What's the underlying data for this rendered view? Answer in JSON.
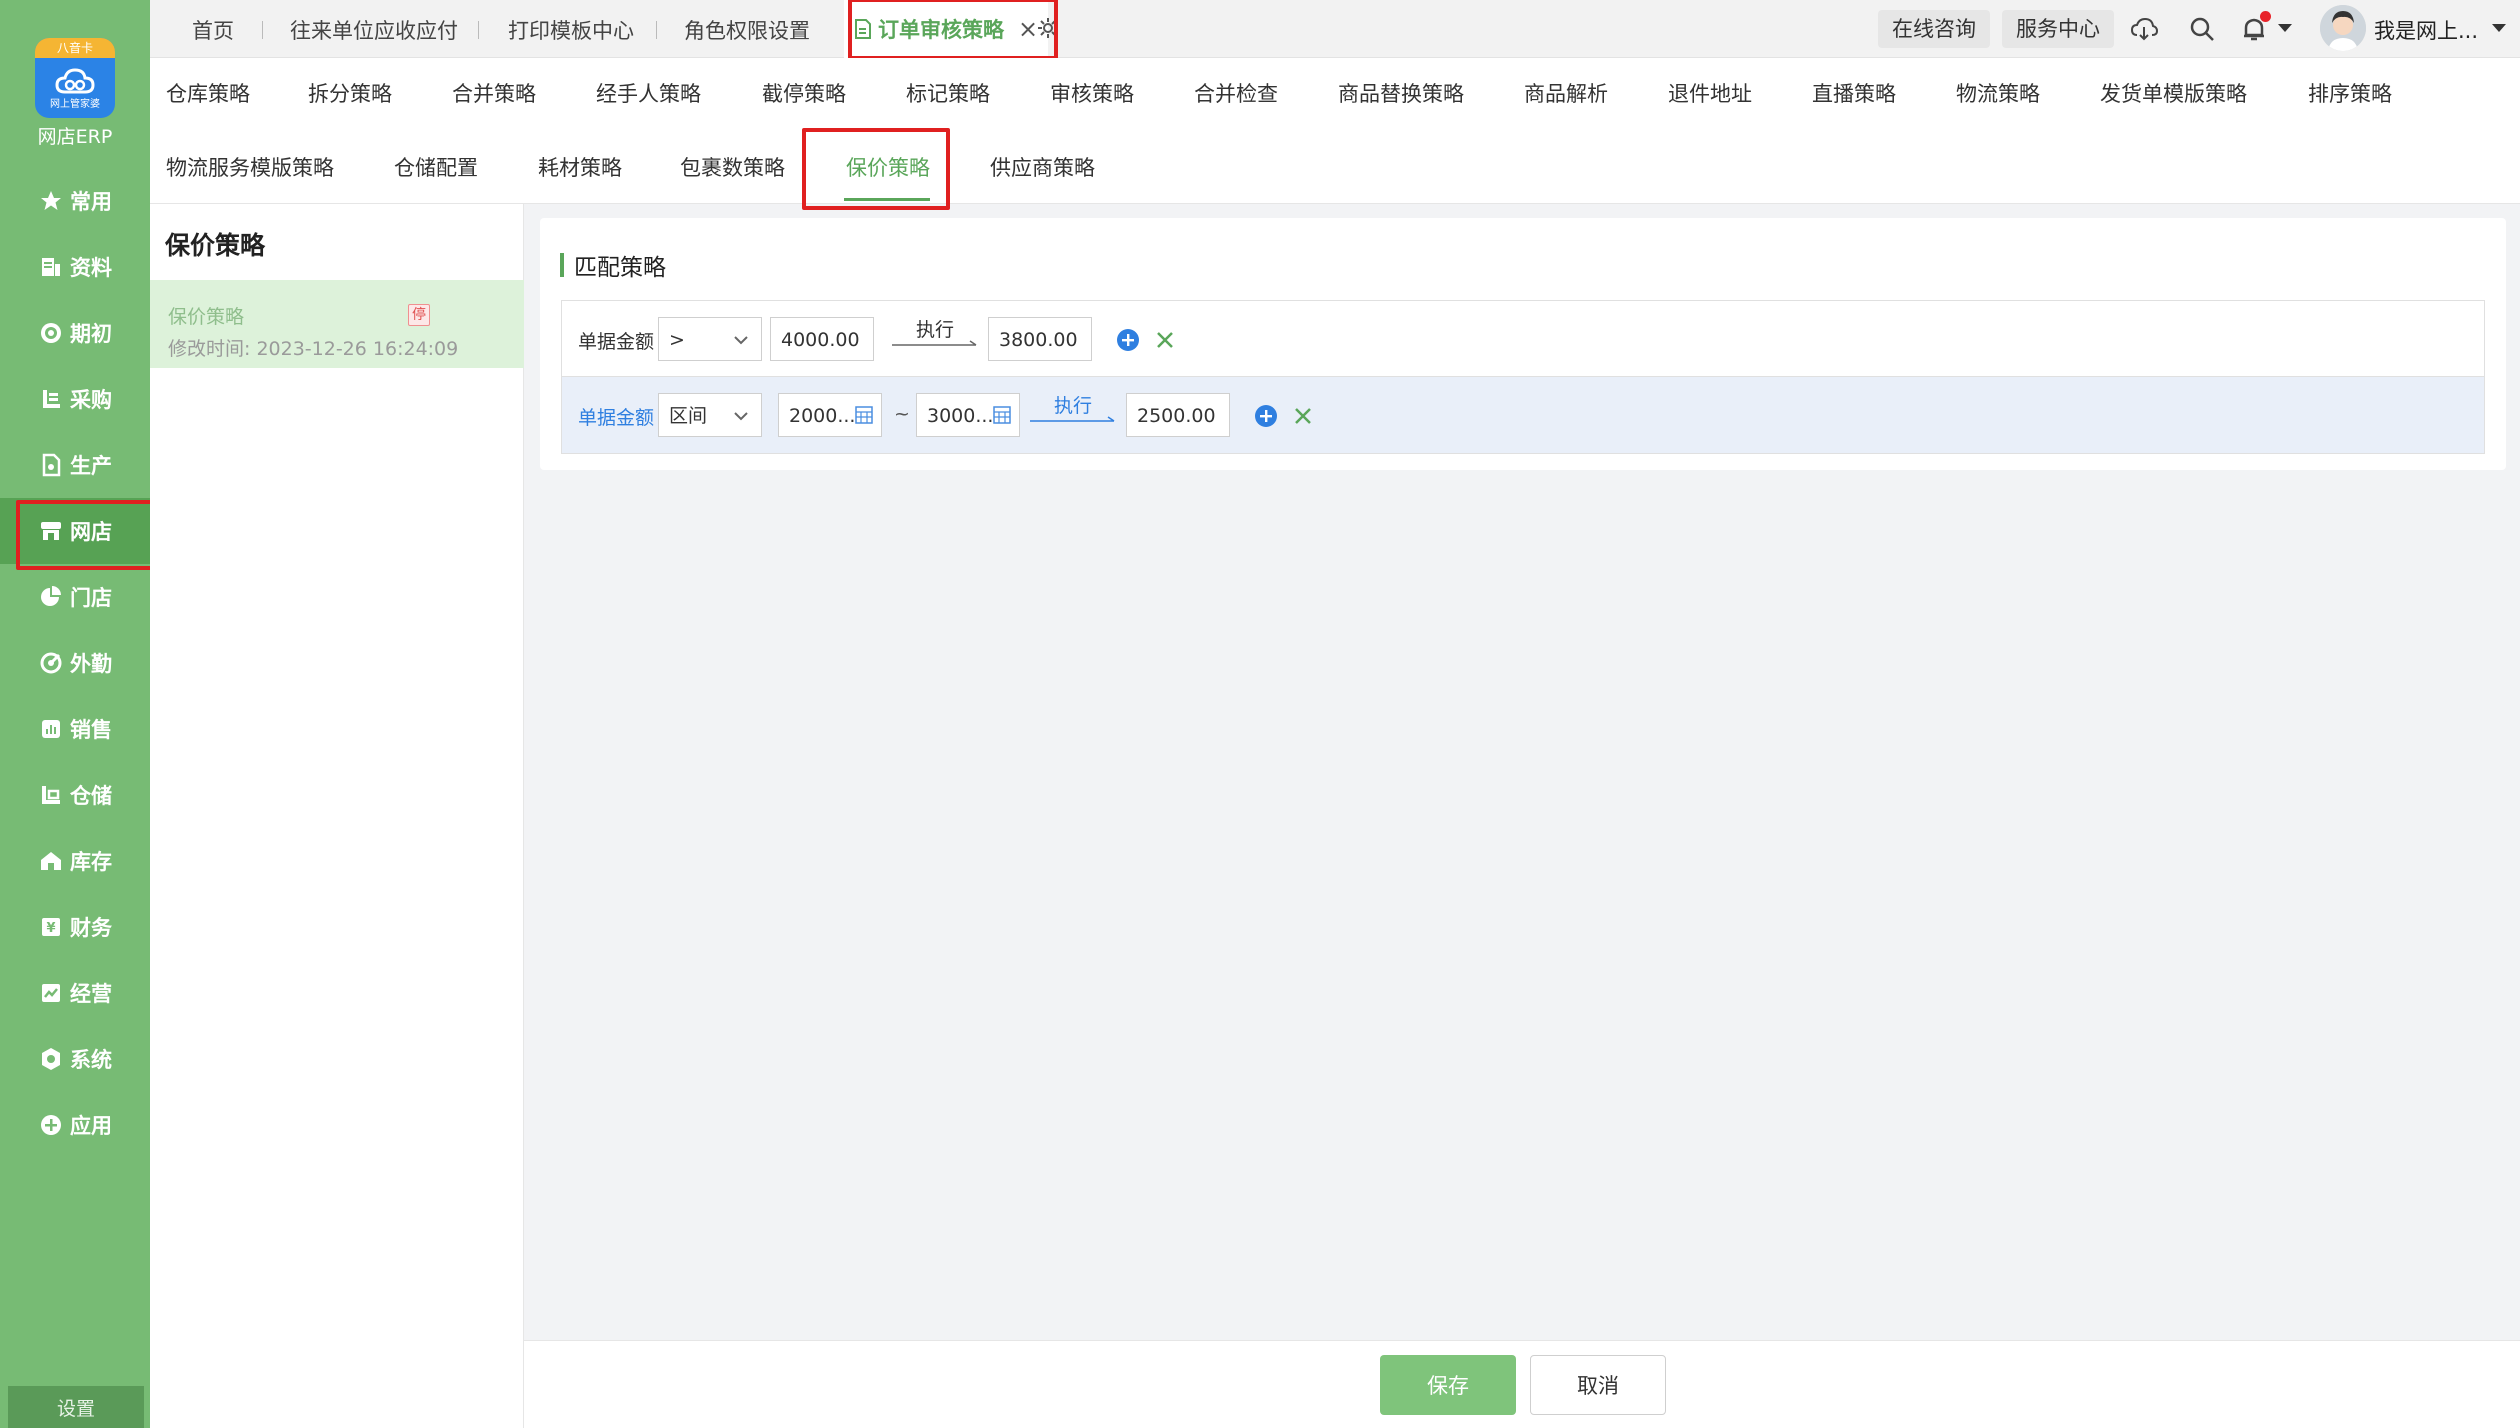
{
  "app": {
    "logo_ribbon": "八音卡",
    "logo_sub": "网上管家婆",
    "name": "网店ERP"
  },
  "sidebar": {
    "items": [
      {
        "label": "常用",
        "icon": "star-icon"
      },
      {
        "label": "资料",
        "icon": "doc-icon"
      },
      {
        "label": "期初",
        "icon": "target-icon"
      },
      {
        "label": "采购",
        "icon": "purchase-icon"
      },
      {
        "label": "生产",
        "icon": "production-icon"
      },
      {
        "label": "网店",
        "icon": "shop-icon",
        "active": true
      },
      {
        "label": "门店",
        "icon": "pie-icon"
      },
      {
        "label": "外勤",
        "icon": "field-icon"
      },
      {
        "label": "销售",
        "icon": "chart-icon"
      },
      {
        "label": "仓储",
        "icon": "warehouse-icon"
      },
      {
        "label": "库存",
        "icon": "house-icon"
      },
      {
        "label": "财务",
        "icon": "finance-icon"
      },
      {
        "label": "经营",
        "icon": "business-icon"
      },
      {
        "label": "系统",
        "icon": "gear-icon"
      },
      {
        "label": "应用",
        "icon": "plus-icon"
      }
    ],
    "settings_label": "设置"
  },
  "topbar": {
    "tabs": [
      "首页",
      "往来单位应收应付",
      "打印模板中心",
      "角色权限设置"
    ],
    "active_tab": "订单审核策略",
    "consult": "在线咨询",
    "service": "服务中心",
    "username": "我是网上..."
  },
  "strategy_tabs": {
    "row1": [
      "仓库策略",
      "拆分策略",
      "合并策略",
      "经手人策略",
      "截停策略",
      "标记策略",
      "审核策略",
      "合并检查",
      "商品替换策略",
      "商品解析",
      "退件地址",
      "直播策略",
      "物流策略",
      "发货单模版策略",
      "排序策略"
    ],
    "row2": [
      "物流服务模版策略",
      "仓储配置",
      "耗材策略",
      "包裹数策略",
      "保价策略",
      "供应商策略"
    ],
    "active": "保价策略"
  },
  "left_panel": {
    "title": "保价策略",
    "items": [
      {
        "name": "保价策略",
        "badge": "停",
        "time": "修改时间: 2023-12-26 16:24:09"
      }
    ]
  },
  "main": {
    "section_title": "匹配策略",
    "rules": [
      {
        "label": "单据金额",
        "operator": ">",
        "value": "4000.00",
        "action": "执行",
        "result": "3800.00"
      },
      {
        "label": "单据金额",
        "operator": "区间",
        "from": "2000...",
        "to": "3000...",
        "range_sep": "~",
        "action": "执行",
        "result": "2500.00"
      }
    ]
  },
  "footer": {
    "save": "保存",
    "cancel": "取消"
  },
  "colors": {
    "brand_green": "#77bb74",
    "accent_green": "#5aa65a",
    "link_blue": "#2f7fe0",
    "highlight_red": "#e02020"
  }
}
